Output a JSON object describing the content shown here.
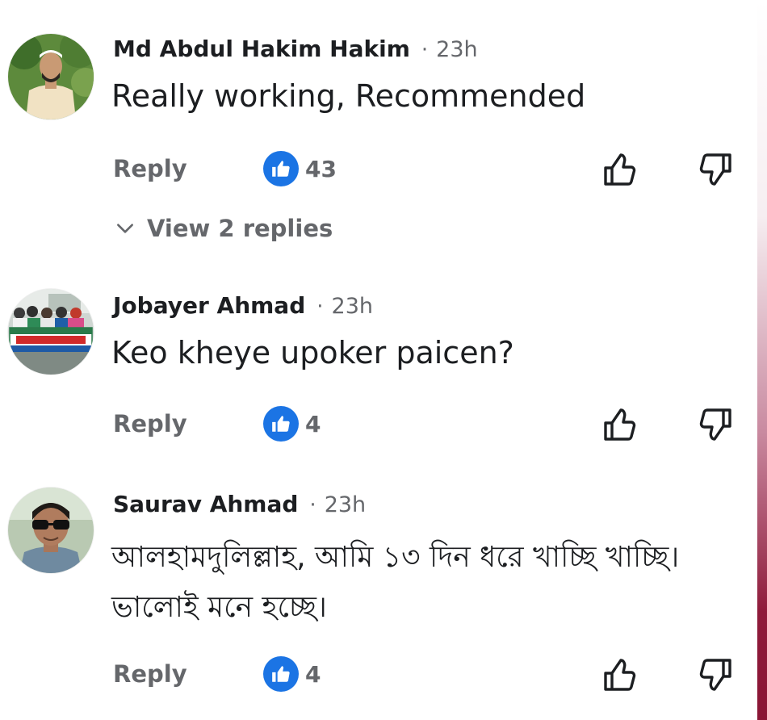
{
  "comments": [
    {
      "author": "Md Abdul Hakim Hakim",
      "time": "23h",
      "text": "Really working, Recommended",
      "reply_label": "Reply",
      "like_count": "43",
      "view_replies_label": "View 2 replies",
      "avatar_icon": "person-avatar"
    },
    {
      "author": "Jobayer Ahmad",
      "time": "23h",
      "text": "Keo kheye upoker paicen?",
      "reply_label": "Reply",
      "like_count": "4",
      "avatar_icon": "group-banner-avatar"
    },
    {
      "author": "Saurav Ahmad",
      "time": "23h",
      "text": "আলহামদুলিল্লাহ, আমি ১৩ দিন ধরে খাচ্ছি খাচ্ছি। ভালোই মনে হচ্ছে।",
      "reply_label": "Reply",
      "like_count": "4",
      "avatar_icon": "person-sunglasses-avatar"
    }
  ],
  "separator": "·",
  "colors": {
    "like_blue": "#1b74e4",
    "secondary_text": "#65676b",
    "primary_text": "#1c1e21",
    "edge_accent": "#8a1535"
  },
  "icons": {
    "like_badge": "thumbs-up-icon",
    "upvote": "thumb-up-outline-icon",
    "downvote": "thumb-down-outline-icon",
    "expand": "chevron-down-icon"
  }
}
